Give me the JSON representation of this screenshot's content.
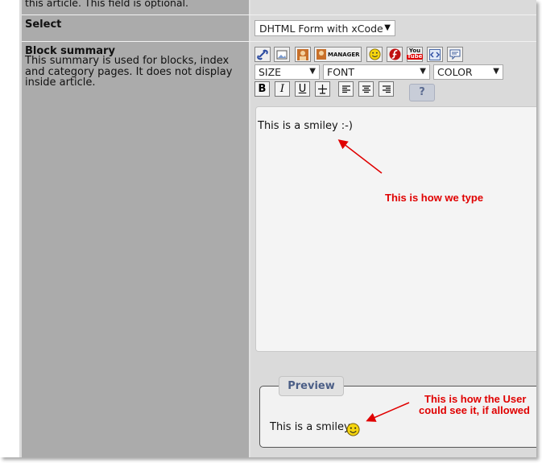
{
  "form": {
    "top_label_fragment": "this article. This field is optional.",
    "select_label": "Select",
    "select_value": "DHTML Form with xCode",
    "block_summary_title": "Block summary",
    "block_summary_desc": "This summary is used for blocks, index and category pages. It does not display inside article."
  },
  "toolbar": {
    "buttons": [
      "link-icon",
      "image-icon",
      "avatar-icon",
      "manager",
      "smiley-icon",
      "flash-icon",
      "youtube-icon",
      "code-icon",
      "quote-icon"
    ],
    "manager_label": "MANAGER",
    "youtube_label_top": "You",
    "youtube_label_bottom": "Tube",
    "size_label": "SIZE",
    "font_label": "FONT",
    "color_label": "COLOR",
    "bold_label": "B",
    "italic_label": "I",
    "underline_label": "U",
    "strike_label": "±",
    "help_label": "?"
  },
  "editor": {
    "text": "This is a smiley :-)"
  },
  "annotations": {
    "typing_note": "This is how we type",
    "preview_note_line1": "This is how the User",
    "preview_note_line2": "could see it, if allowed",
    "color": "#e00000"
  },
  "preview": {
    "legend": "Preview",
    "text": "This is a smiley"
  }
}
